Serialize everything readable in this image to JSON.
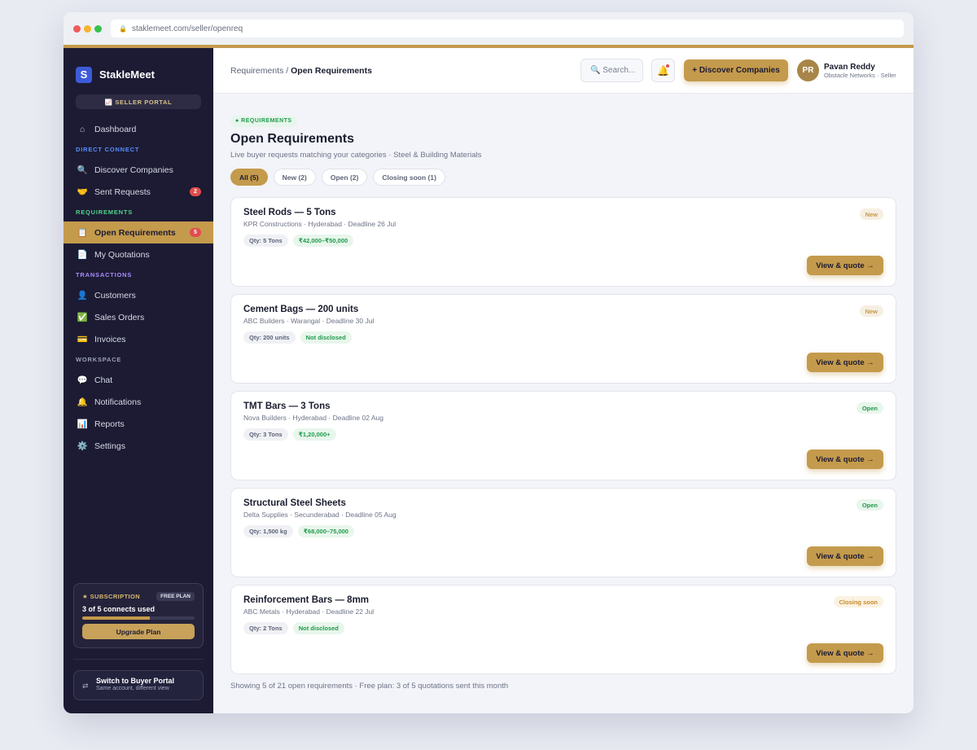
{
  "browser": {
    "url": "staklemeet.com/seller/openreq"
  },
  "brand": {
    "name": "StakleMeet",
    "logo_glyph": "S",
    "portal_badge": "📈 SELLER PORTAL"
  },
  "sidebar": {
    "dashboard": {
      "label": "Dashboard",
      "icon": "home-icon"
    },
    "sections": {
      "direct_connect": "DIRECT CONNECT",
      "requirements": "REQUIREMENTS",
      "transactions": "TRANSACTIONS",
      "workspace": "WORKSPACE"
    },
    "items": [
      {
        "label": "Discover Companies",
        "icon": "search-icon"
      },
      {
        "label": "Sent Requests",
        "icon": "handshake-icon",
        "count": "2"
      },
      {
        "label": "Open Requirements",
        "icon": "clipboard-icon",
        "count": "5"
      },
      {
        "label": "My Quotations",
        "icon": "document-icon"
      },
      {
        "label": "Customers",
        "icon": "user-icon"
      },
      {
        "label": "Sales Orders",
        "icon": "check-icon"
      },
      {
        "label": "Invoices",
        "icon": "card-icon"
      },
      {
        "label": "Chat",
        "icon": "chat-icon"
      },
      {
        "label": "Notifications",
        "icon": "bell-icon"
      },
      {
        "label": "Reports",
        "icon": "chart-icon"
      },
      {
        "label": "Settings",
        "icon": "gear-icon"
      }
    ],
    "subscription": {
      "title": "★ SUBSCRIPTION",
      "plan": "FREE PLAN",
      "used": "3 of 5 connects used",
      "progress": 0.6,
      "upgrade_label": "Upgrade Plan"
    },
    "switch": {
      "title": "Switch to Buyer Portal",
      "subtitle": "Same account, different view"
    }
  },
  "header": {
    "breadcrumb_parent": "Requirements",
    "breadcrumb_sep": " / ",
    "breadcrumb_current": "Open Requirements",
    "search_placeholder": "🔍 Search...",
    "discover_label": "+ Discover Companies",
    "user": {
      "initials": "PR",
      "name": "Pavan Reddy",
      "subtitle": "Obstacle Networks · Seller"
    }
  },
  "page": {
    "tag": "● REQUIREMENTS",
    "title": "Open Requirements",
    "subtitle": "Live buyer requests matching your categories · Steel & Building Materials",
    "tabs": [
      "All (5)",
      "New (2)",
      "Open (2)",
      "Closing soon (1)"
    ],
    "active_tab": 0,
    "footer": "Showing 5 of 21 open requirements · Free plan: 3 of 5 quotations sent this month"
  },
  "requirements": [
    {
      "title": "Steel Rods — 5 Tons",
      "meta": "KPR Constructions · Hyderabad · Deadline 26 Jul",
      "qty": "Qty: 5 Tons",
      "price": "₹42,000–₹50,000",
      "status": "New",
      "action": "View & quote →"
    },
    {
      "title": "Cement Bags — 200 units",
      "meta": "ABC Builders · Warangal · Deadline 30 Jul",
      "qty": "Qty: 200 units",
      "price": "Not disclosed",
      "status": "New",
      "action": "View & quote →"
    },
    {
      "title": "TMT Bars — 3 Tons",
      "meta": "Nova Builders · Hyderabad · Deadline 02 Aug",
      "qty": "Qty: 3 Tons",
      "price": "₹1,20,000+",
      "status": "Open",
      "action": "View & quote →"
    },
    {
      "title": "Structural Steel Sheets",
      "meta": "Delta Supplies · Secunderabad · Deadline 05 Aug",
      "qty": "Qty: 1,500 kg",
      "price": "₹68,000–75,000",
      "status": "Open",
      "action": "View & quote →"
    },
    {
      "title": "Reinforcement Bars — 8mm",
      "meta": "ABC Metals · Hyderabad · Deadline 22 Jul",
      "qty": "Qty: 2 Tons",
      "price": "Not disclosed",
      "status": "Closing soon",
      "action": "View & quote →"
    }
  ],
  "colors": {
    "accent": "#c49a4c",
    "sidebar_bg": "#1c1b33",
    "section_direct": "#5b8cff",
    "section_requirements": "#4fd58a",
    "section_transactions": "#a98cff",
    "section_workspace": "#9aa0b8"
  }
}
